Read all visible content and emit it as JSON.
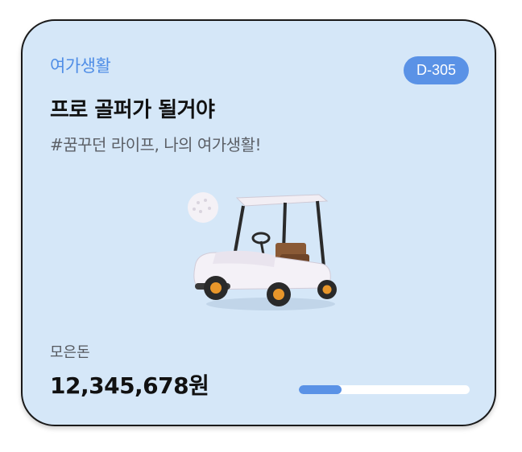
{
  "card": {
    "category": "여가생활",
    "dday": "D-305",
    "title": "프로 골퍼가 될거야",
    "subtitle": "#꿈꾸던 라이프, 나의 여가생활!",
    "illustration_icon": "golf-cart-icon",
    "saved_label": "모은돈",
    "saved_amount": "12,345,678원",
    "progress": 0.25
  },
  "colors": {
    "card_background": "#d5e7f8",
    "accent": "#5a92e6",
    "category_text": "#4f8de6"
  }
}
